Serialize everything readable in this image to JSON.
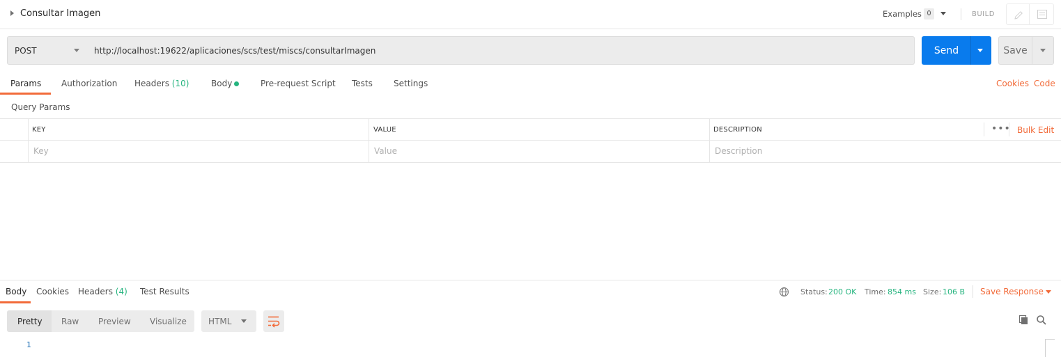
{
  "request": {
    "title": "Consultar Imagen",
    "examples_label": "Examples",
    "examples_count": "0",
    "build_label": "BUILD",
    "method": "POST",
    "url": "http://localhost:19622/aplicaciones/scs/test/miscs/consultarImagen",
    "send_label": "Send",
    "save_label": "Save"
  },
  "request_tabs": {
    "params": "Params",
    "authorization": "Authorization",
    "headers": "Headers",
    "headers_count": "(10)",
    "body": "Body",
    "prerequest": "Pre-request Script",
    "tests": "Tests",
    "settings": "Settings",
    "cookies": "Cookies",
    "code": "Code"
  },
  "params": {
    "section_label": "Query Params",
    "columns": {
      "key": "KEY",
      "value": "VALUE",
      "description": "DESCRIPTION"
    },
    "placeholders": {
      "key": "Key",
      "value": "Value",
      "description": "Description"
    },
    "more": "•••",
    "bulk_edit": "Bulk Edit"
  },
  "response_tabs": {
    "body": "Body",
    "cookies": "Cookies",
    "headers": "Headers",
    "headers_count": "(4)",
    "test_results": "Test Results"
  },
  "response_status": {
    "status_label": "Status:",
    "status_value": "200 OK",
    "time_label": "Time:",
    "time_value": "854 ms",
    "size_label": "Size:",
    "size_value": "106 B",
    "save_response": "Save Response"
  },
  "response_view": {
    "formats": [
      "Pretty",
      "Raw",
      "Preview",
      "Visualize"
    ],
    "language": "HTML",
    "line_numbers": [
      "1"
    ]
  },
  "colors": {
    "accent_orange": "#F26B3A",
    "send_blue": "#097BED",
    "success_green": "#26B47F"
  }
}
